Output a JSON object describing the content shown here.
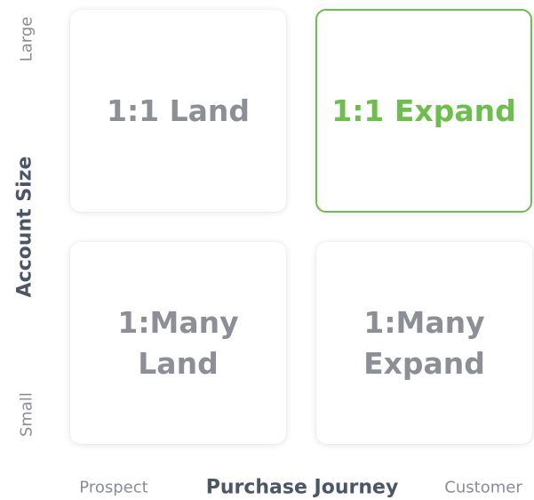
{
  "axes": {
    "y": {
      "title": "Account Size",
      "top": "Large",
      "bottom": "Small"
    },
    "x": {
      "title": "Purchase Journey",
      "left": "Prospect",
      "right": "Customer"
    }
  },
  "quadrants": [
    {
      "id": "top-left",
      "label": "1:1 Land",
      "selected": false
    },
    {
      "id": "top-right",
      "label": "1:1 Expand",
      "selected": true
    },
    {
      "id": "bottom-left",
      "label": "1:Many\nLand",
      "selected": false
    },
    {
      "id": "bottom-right",
      "label": "1:Many\nExpand",
      "selected": false
    }
  ],
  "colors": {
    "accent": "#6dbf4b",
    "quadrant_text": "#8c8f96",
    "axis_title": "#4d5666",
    "axis_minor": "#8a8d93"
  }
}
